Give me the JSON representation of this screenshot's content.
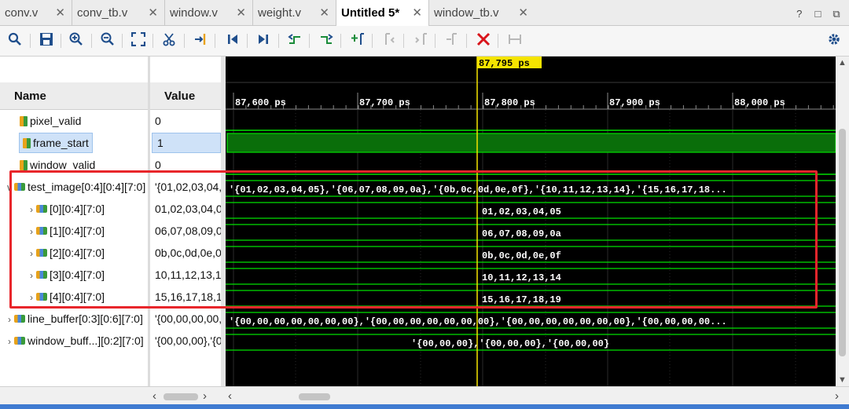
{
  "tabs": [
    {
      "label": "conv.v",
      "active": false
    },
    {
      "label": "conv_tb.v",
      "active": false
    },
    {
      "label": "window.v",
      "active": false
    },
    {
      "label": "weight.v",
      "active": false
    },
    {
      "label": "Untitled 5*",
      "active": true
    },
    {
      "label": "window_tb.v",
      "active": false
    }
  ],
  "window_controls": {
    "help": "?",
    "restore": "□",
    "float": "⧉"
  },
  "toolbar": {
    "icons": [
      "search-icon",
      "save-icon",
      "zoom-in-icon",
      "zoom-out-icon",
      "zoom-fit-icon",
      "scissors-icon",
      "go-to-cursor-icon",
      "go-to-time-zero-icon",
      "go-to-last-time-icon",
      "previous-transition-icon",
      "next-transition-icon",
      "add-marker-icon",
      "previous-marker-icon",
      "next-marker-icon",
      "swap-cursors-icon",
      "delete-icon",
      "snap-icon",
      "gear-icon"
    ]
  },
  "panels": {
    "name_header": "Name",
    "value_header": "Value"
  },
  "cursor": {
    "time_label": "87,795 ps"
  },
  "timeline": {
    "ticks": [
      "87,600 ps",
      "87,700 ps",
      "87,800 ps",
      "87,900 ps",
      "88,000 ps"
    ]
  },
  "signals": [
    {
      "name": "pixel_valid",
      "value": "0",
      "kind": "bit"
    },
    {
      "name": "frame_start",
      "value": "1",
      "kind": "bit",
      "selected": true
    },
    {
      "name": "window_valid",
      "value": "0",
      "kind": "bit"
    },
    {
      "name": "test_image[0:4][0:4][7:0]",
      "value": "'{01,02,03,04,05},'{06,07,08,09,0a},...",
      "kind": "bus",
      "expanded": true,
      "wave_text": "'{01,02,03,04,05},'{06,07,08,09,0a},'{0b,0c,0d,0e,0f},'{10,11,12,13,14},'{15,16,17,18..."
    },
    {
      "name": "[0][0:4][7:0]",
      "value": "01,02,03,04,05",
      "kind": "bus",
      "wave_text": "01,02,03,04,05"
    },
    {
      "name": "[1][0:4][7:0]",
      "value": "06,07,08,09,0a",
      "kind": "bus",
      "wave_text": "06,07,08,09,0a"
    },
    {
      "name": "[2][0:4][7:0]",
      "value": "0b,0c,0d,0e,0f",
      "kind": "bus",
      "wave_text": "0b,0c,0d,0e,0f"
    },
    {
      "name": "[3][0:4][7:0]",
      "value": "10,11,12,13,14",
      "kind": "bus",
      "wave_text": "10,11,12,13,14"
    },
    {
      "name": "[4][0:4][7:0]",
      "value": "15,16,17,18,19",
      "kind": "bus",
      "wave_text": "15,16,17,18,19"
    },
    {
      "name": "line_buffer[0:3][0:6][7:0]",
      "value": "'{00,00,00,00,00,00,00},...",
      "kind": "bus",
      "wave_text": "'{00,00,00,00,00,00,00},'{00,00,00,00,00,00,00},'{00,00,00,00,00,00,00},'{00,00,00,00..."
    },
    {
      "name": "window_buff...][0:2][7:0]",
      "value": "'{00,00,00},'{00,00,00},'{00,00,00}",
      "kind": "bus",
      "wave_text": "'{00,00,00},'{00,00,00},'{00,00,00}"
    }
  ],
  "colors": {
    "wave_green": "#00e000",
    "cursor_yellow": "#f5e400",
    "highlight_red": "#e8262b",
    "selected_blue": "#cfe2f8"
  }
}
